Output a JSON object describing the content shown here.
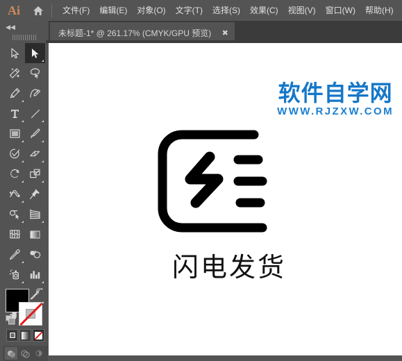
{
  "app": {
    "name": "Ai",
    "brand_color": "#cf8a58",
    "home_icon": "home-icon"
  },
  "menubar": {
    "items": [
      {
        "label": "文件(F)",
        "name": "menu-file"
      },
      {
        "label": "编辑(E)",
        "name": "menu-edit"
      },
      {
        "label": "对象(O)",
        "name": "menu-object"
      },
      {
        "label": "文字(T)",
        "name": "menu-type"
      },
      {
        "label": "选择(S)",
        "name": "menu-select"
      },
      {
        "label": "效果(C)",
        "name": "menu-effect"
      },
      {
        "label": "视图(V)",
        "name": "menu-view"
      },
      {
        "label": "窗口(W)",
        "name": "menu-window"
      },
      {
        "label": "帮助(H)",
        "name": "menu-help"
      }
    ]
  },
  "tabbar": {
    "collapse_icon": "double-chevron-left-icon",
    "document_tab": {
      "title": "未标题-1* @ 261.17% (CMYK/GPU 预览)",
      "close_label": "✖",
      "zoom_level": "261.17%",
      "color_mode": "CMYK",
      "preview_mode": "GPU 预览",
      "modified": true
    }
  },
  "toolbar": {
    "tools": [
      {
        "name": "selection-tool",
        "icon": "arrow-outline-icon",
        "active": false,
        "has_flyout": false
      },
      {
        "name": "direct-selection-tool",
        "icon": "arrow-filled-icon",
        "active": true,
        "has_flyout": true
      },
      {
        "name": "magic-wand-tool",
        "icon": "magic-wand-icon",
        "active": false,
        "has_flyout": false
      },
      {
        "name": "lasso-tool",
        "icon": "lasso-icon",
        "active": false,
        "has_flyout": false
      },
      {
        "name": "pen-tool",
        "icon": "pen-icon",
        "active": false,
        "has_flyout": true
      },
      {
        "name": "curvature-tool",
        "icon": "curvature-pen-icon",
        "active": false,
        "has_flyout": false
      },
      {
        "name": "type-tool",
        "icon": "type-t-icon",
        "active": false,
        "has_flyout": true
      },
      {
        "name": "line-segment-tool",
        "icon": "line-diagonal-icon",
        "active": false,
        "has_flyout": true
      },
      {
        "name": "rectangle-tool",
        "icon": "rectangle-icon",
        "active": false,
        "has_flyout": true
      },
      {
        "name": "paintbrush-tool",
        "icon": "paintbrush-icon",
        "active": false,
        "has_flyout": true
      },
      {
        "name": "shaper-tool",
        "icon": "shaper-check-icon",
        "active": false,
        "has_flyout": true
      },
      {
        "name": "eraser-tool",
        "icon": "eraser-icon",
        "active": false,
        "has_flyout": true
      },
      {
        "name": "rotate-tool",
        "icon": "rotate-icon",
        "active": false,
        "has_flyout": true
      },
      {
        "name": "scale-tool",
        "icon": "scale-icon",
        "active": false,
        "has_flyout": true
      },
      {
        "name": "width-tool",
        "icon": "width-warp-icon",
        "active": false,
        "has_flyout": true
      },
      {
        "name": "free-transform-tool",
        "icon": "pushpin-icon",
        "active": false,
        "has_flyout": false
      },
      {
        "name": "shape-builder-tool",
        "icon": "shape-builder-icon",
        "active": false,
        "has_flyout": true
      },
      {
        "name": "perspective-grid-tool",
        "icon": "perspective-grid-icon",
        "active": false,
        "has_flyout": true
      },
      {
        "name": "mesh-tool",
        "icon": "mesh-icon",
        "active": false,
        "has_flyout": false
      },
      {
        "name": "gradient-tool",
        "icon": "gradient-icon",
        "active": false,
        "has_flyout": false
      },
      {
        "name": "eyedropper-tool",
        "icon": "eyedropper-icon",
        "active": false,
        "has_flyout": true
      },
      {
        "name": "blend-tool",
        "icon": "blend-circles-icon",
        "active": false,
        "has_flyout": false
      },
      {
        "name": "symbol-sprayer-tool",
        "icon": "symbol-sprayer-icon",
        "active": false,
        "has_flyout": true
      },
      {
        "name": "column-graph-tool",
        "icon": "bar-chart-icon",
        "active": false,
        "has_flyout": true
      },
      {
        "name": "artboard-tool",
        "icon": "artboard-icon",
        "active": false,
        "has_flyout": false
      },
      {
        "name": "slice-tool",
        "icon": "slice-knife-icon",
        "active": false,
        "has_flyout": true
      },
      {
        "name": "hand-tool",
        "icon": "hand-icon",
        "active": false,
        "has_flyout": true
      },
      {
        "name": "zoom-tool",
        "icon": "magnifier-icon",
        "active": false,
        "has_flyout": false
      }
    ],
    "colors": {
      "fill": "#000000",
      "stroke": "none",
      "swap_icon": "swap-arrows-icon",
      "defaults_icon": "default-colors-icon"
    },
    "fill_modes": [
      {
        "name": "color-mode-button",
        "icon": "solid-color-icon",
        "selected": false
      },
      {
        "name": "gradient-mode-button",
        "icon": "gradient-icon",
        "selected": false
      },
      {
        "name": "none-mode-button",
        "icon": "no-color-icon",
        "selected": true
      }
    ],
    "draw_modes": [
      {
        "name": "draw-normal-button",
        "icon": "draw-normal-icon",
        "selected": true
      },
      {
        "name": "draw-behind-button",
        "icon": "draw-behind-icon",
        "selected": false
      },
      {
        "name": "draw-inside-button",
        "icon": "draw-inside-icon",
        "selected": false
      }
    ]
  },
  "canvas": {
    "background": "#ffffff",
    "artwork": {
      "name": "lightning-delivery-logo",
      "description": "rounded open rectangle with lightning bolt and three horizontal bars",
      "color": "#000000"
    },
    "caption": "闪电发货"
  },
  "watermark": {
    "chinese": "软件自学网",
    "url": "WWW.RJZXW.COM",
    "color": "#1577c8"
  }
}
